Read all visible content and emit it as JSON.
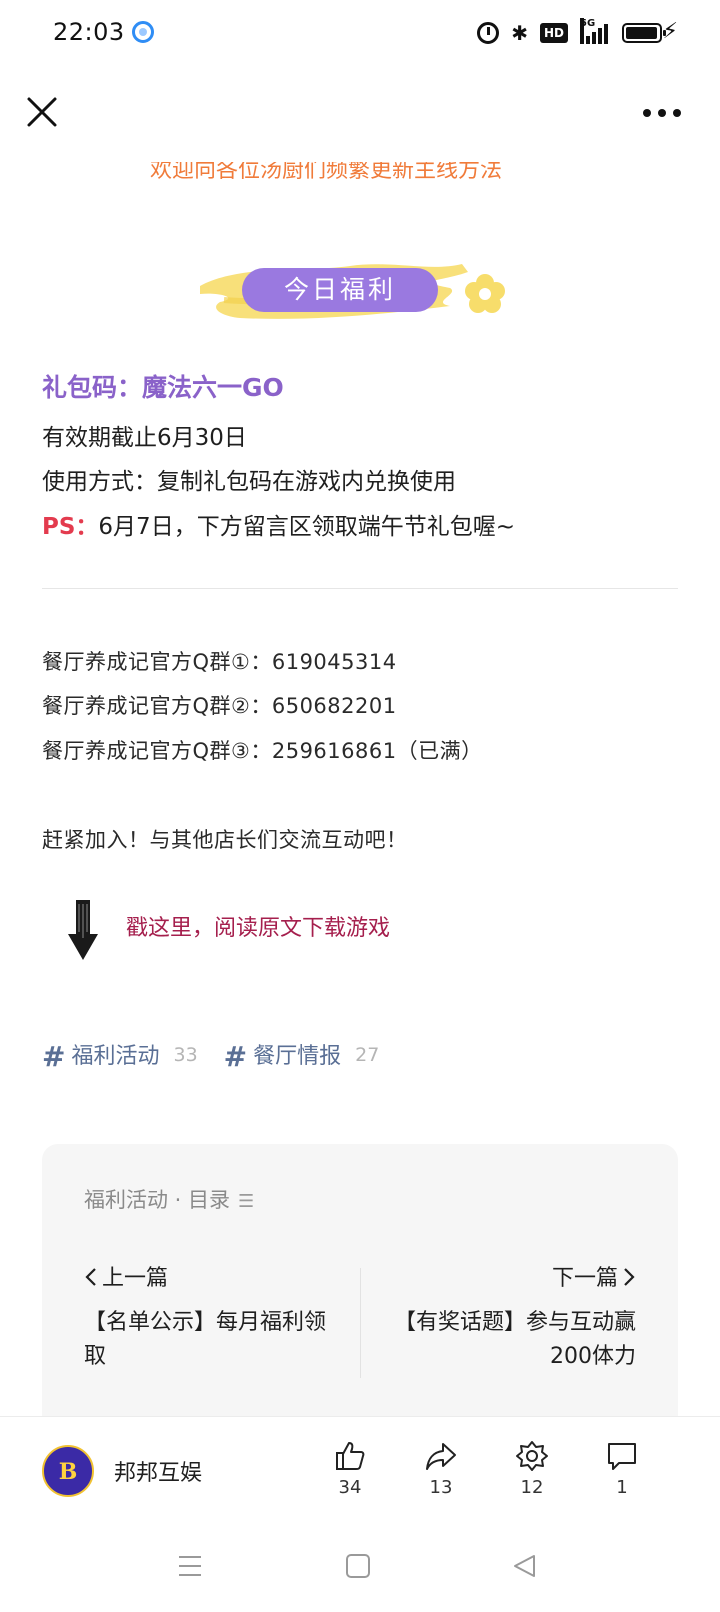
{
  "status_bar": {
    "time": "22:03",
    "app_icon": "browser-notification-icon",
    "icons": [
      "alarm-icon",
      "bluetooth-icon",
      "hd-icon",
      "5g-signal-icon",
      "battery-icon",
      "charging-icon"
    ],
    "hd_label": "HD",
    "network_label": "5G"
  },
  "nav": {
    "close_icon": "close-icon",
    "more_icon": "more-icon"
  },
  "article": {
    "cut_off_text": "欢迎向各位汤厨们频繁更新主线方法",
    "banner_label": "今日福利",
    "gift_code": "礼包码：魔法六一GO",
    "validity": "有效期截止6月30日",
    "usage": "使用方式：复制礼包码在游戏内兑换使用",
    "ps_label": "PS：",
    "ps_text": "6月7日，下方留言区领取端午节礼包喔~",
    "qq_groups": [
      "餐厅养成记官方Q群①：619045314",
      "餐厅养成记官方Q群②：650682201",
      "餐厅养成记官方Q群③：259616861（已满）"
    ],
    "join_text": "赶紧加入！与其他店长们交流互动吧！",
    "read_link": "戳这里，阅读原文下载游戏",
    "tags": [
      {
        "label": "福利活动",
        "count": "33"
      },
      {
        "label": "餐厅情报",
        "count": "27"
      }
    ],
    "toc": {
      "title": "福利活动 · 目录",
      "prev_label": "上一篇",
      "prev_title": "【名单公示】每月福利领取",
      "next_label": "下一篇",
      "next_title": "【有奖话题】参与互动赢200体力"
    }
  },
  "action_bar": {
    "account_name": "邦邦互娱",
    "avatar_text": "B",
    "like_count": "34",
    "share_count": "13",
    "favorite_count": "12",
    "comment_count": "1"
  },
  "colors": {
    "accent_purple": "#9a79e0",
    "gift_code_purple": "#8a62c9",
    "ps_red": "#e33b4e",
    "link_red": "#a51f4d",
    "tag_blue": "#5a6f95",
    "highlight_yellow": "#f7dd6b"
  }
}
